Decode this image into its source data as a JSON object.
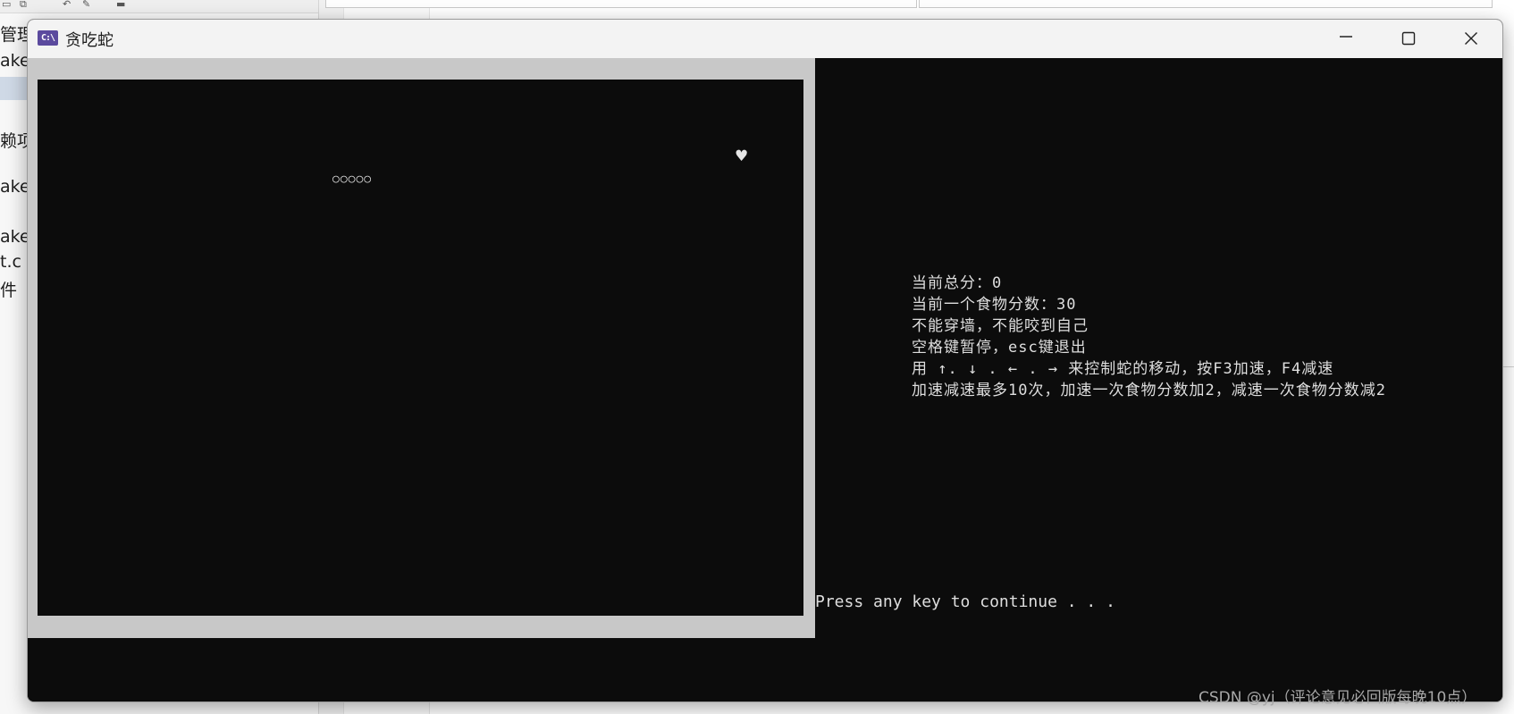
{
  "background_ide": {
    "explorer_fragments": [
      "管理",
      "ake'",
      "赖项",
      "ake.l",
      "ake.c",
      "t.c",
      "件"
    ]
  },
  "window": {
    "title": "贪吃蛇",
    "icon_text": "C:\\",
    "controls": [
      "minimize-icon",
      "maximize-icon",
      "close-icon"
    ]
  },
  "game": {
    "snake": "○○○○○",
    "food": "♥"
  },
  "info": {
    "lines": [
      "当前总分：0",
      "当前一个食物分数：30",
      "不能穿墙，不能咬到自己",
      "空格键暂停，esc键退出",
      "用 ↑. ↓ . ← . → 来控制蛇的移动，按F3加速，F4减速",
      "加速减速最多10次，加速一次食物分数加2，减速一次食物分数减2"
    ]
  },
  "prompt": "Press any key to continue . . .",
  "watermark": "CSDN @yj（评论意见必回版每晚10点）",
  "colors": {
    "console_bg": "#0c0c0c",
    "console_text": "#dedede",
    "frame_gray": "#c8c8c8",
    "title_bar": "#f3f3f3",
    "icon_purple": "#5b4a9e"
  }
}
